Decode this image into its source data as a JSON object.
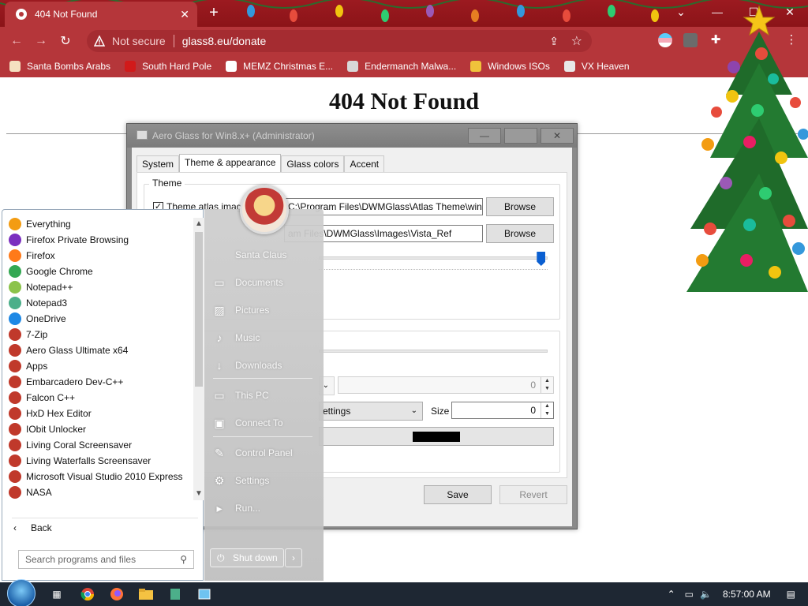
{
  "browser": {
    "tab_title": "404 Not Found",
    "tab_close": "✕",
    "new_tab": "+",
    "window_controls": [
      "⌄",
      "—",
      "☐",
      "✕"
    ],
    "security_label": "Not secure",
    "url": "glass8.eu/donate",
    "bookmarks": [
      {
        "label": "Santa Bombs Arabs",
        "color": "#f5e0c0"
      },
      {
        "label": "South Hard Pole",
        "color": "#d11a1a"
      },
      {
        "label": "MEMZ Christmas E...",
        "color": "#ffffff"
      },
      {
        "label": "Endermanch Malwa...",
        "color": "#d8d8d8"
      },
      {
        "label": "Windows ISOs",
        "color": "#f0c23b"
      },
      {
        "label": "VX Heaven",
        "color": "#e8e8e8"
      }
    ]
  },
  "page": {
    "heading": "404 Not Found"
  },
  "dialog": {
    "title": "Aero Glass for Win8.x+ (Administrator)",
    "tabs": [
      "System",
      "Theme & appearance",
      "Glass colors",
      "Accent"
    ],
    "selected_tab": "Theme & appearance",
    "theme_group_title": "Theme",
    "theme_atlas_label": "Theme atlas image",
    "theme_atlas_checked": true,
    "theme_atlas_path": "C:\\Program Files\\DWMGlass\\Atlas Theme\\win",
    "second_path": "am Files\\DWMGlass\\Images\\Vista_Ref",
    "browse_label": "Browse",
    "slider_level": 0.97,
    "spin_value_1": "0",
    "font_combo": "ettings",
    "size_label": "Size",
    "size_value": "0",
    "color_swatch": "#000000",
    "save_label": "Save",
    "revert_label": "Revert"
  },
  "start_menu": {
    "programs": [
      {
        "label": "Everything",
        "color": "#f39c12"
      },
      {
        "label": "Firefox Private Browsing",
        "color": "#7b2fbf"
      },
      {
        "label": "Firefox",
        "color": "#ff7a1a"
      },
      {
        "label": "Google Chrome",
        "color": "#34a853"
      },
      {
        "label": "Notepad++",
        "color": "#8bc34a"
      },
      {
        "label": "Notepad3",
        "color": "#4caf8a"
      },
      {
        "label": "OneDrive",
        "color": "#1e88e5"
      },
      {
        "label": "7-Zip",
        "color": "#c0392b"
      },
      {
        "label": "Aero Glass Ultimate x64",
        "color": "#c0392b"
      },
      {
        "label": "Apps",
        "color": "#c0392b"
      },
      {
        "label": "Embarcadero Dev-C++",
        "color": "#c0392b"
      },
      {
        "label": "Falcon C++",
        "color": "#c0392b"
      },
      {
        "label": "HxD Hex Editor",
        "color": "#c0392b"
      },
      {
        "label": "IObit Unlocker",
        "color": "#c0392b"
      },
      {
        "label": "Living Coral Screensaver",
        "color": "#c0392b"
      },
      {
        "label": "Living Waterfalls Screensaver",
        "color": "#c0392b"
      },
      {
        "label": "Microsoft Visual Studio 2010 Express",
        "color": "#c0392b"
      },
      {
        "label": "NASA",
        "color": "#c0392b"
      }
    ],
    "back_label": "Back",
    "search_placeholder": "Search programs and files",
    "right_items": {
      "user": "Santa Claus",
      "documents": "Documents",
      "pictures": "Pictures",
      "music": "Music",
      "downloads": "Downloads",
      "this_pc": "This PC",
      "connect_to": "Connect To",
      "control_panel": "Control Panel",
      "settings": "Settings",
      "run": "Run..."
    },
    "shutdown_label": "Shut down"
  },
  "taskbar": {
    "time": "8:57:00 AM"
  }
}
